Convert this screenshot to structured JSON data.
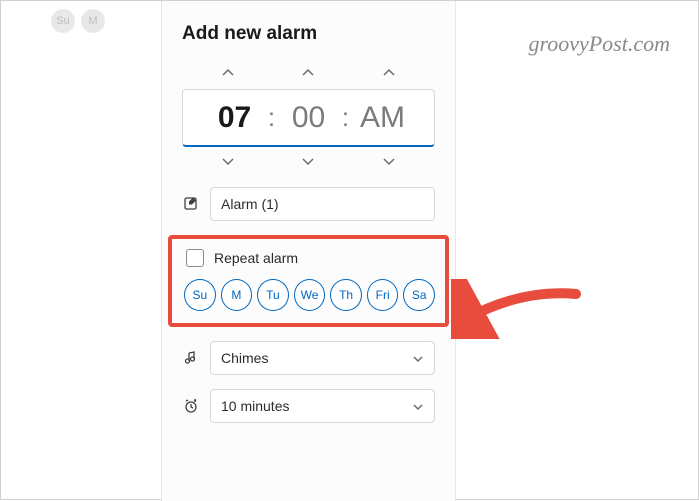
{
  "watermark": "groovyPost.com",
  "topbar": {
    "p1": "Su",
    "p2": "M"
  },
  "panel": {
    "title": "Add new alarm",
    "time": {
      "hour": "07",
      "minute": "00",
      "ampm": "AM"
    },
    "alarm_name": "Alarm (1)",
    "repeat_label": "Repeat alarm",
    "days": [
      "Su",
      "M",
      "Tu",
      "We",
      "Th",
      "Fri",
      "Sa"
    ],
    "sound": "Chimes",
    "snooze": "10 minutes"
  }
}
